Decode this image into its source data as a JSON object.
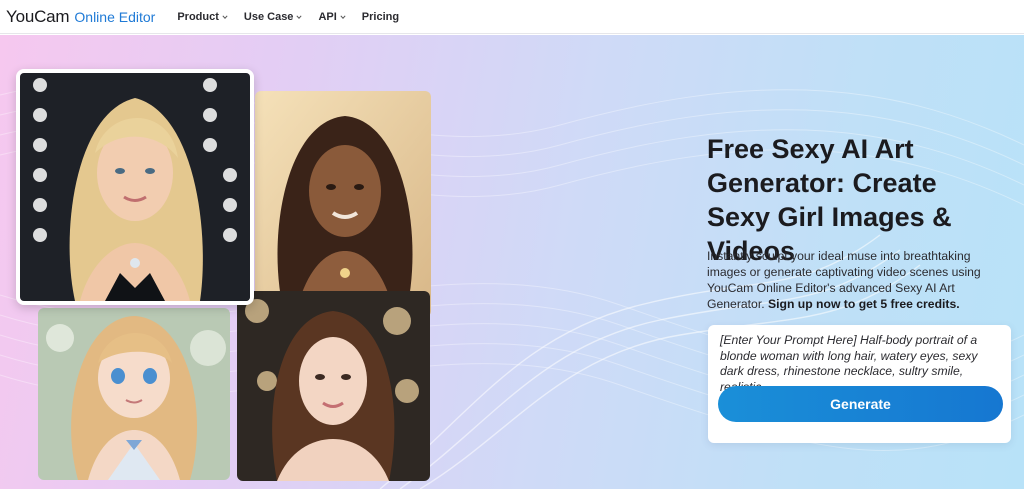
{
  "nav": {
    "logo_main": "YouCam",
    "logo_sub": "Online Editor",
    "items": [
      {
        "label": "Product",
        "has_dropdown": true
      },
      {
        "label": "Use Case",
        "has_dropdown": true
      },
      {
        "label": "API",
        "has_dropdown": true
      },
      {
        "label": "Pricing",
        "has_dropdown": false
      }
    ]
  },
  "hero": {
    "headline": "Free Sexy AI Art Generator: Create Sexy Girl Images & Videos",
    "description": "Instantly sculpt your ideal muse into breathtaking images or generate captivating video scenes using YouCam Online Editor's advanced Sexy AI Art Generator.",
    "description_cta": "Sign up now to get 5 free credits.",
    "prompt_text": "[Enter Your Prompt Here] Half-body portrait of a blonde woman with long hair, watery eyes, sexy dark dress, rhinestone necklace, sultry smile, realistic.",
    "generate_label": "Generate"
  },
  "gallery": [
    {
      "name": "blonde-woman-portrait"
    },
    {
      "name": "dark-haired-woman-portrait"
    },
    {
      "name": "anime-blonde-girl-portrait"
    },
    {
      "name": "brunette-woman-portrait"
    }
  ],
  "colors": {
    "brand_blue": "#1f7ad6",
    "button": "#1680d4",
    "headline": "#1b1b1f"
  }
}
